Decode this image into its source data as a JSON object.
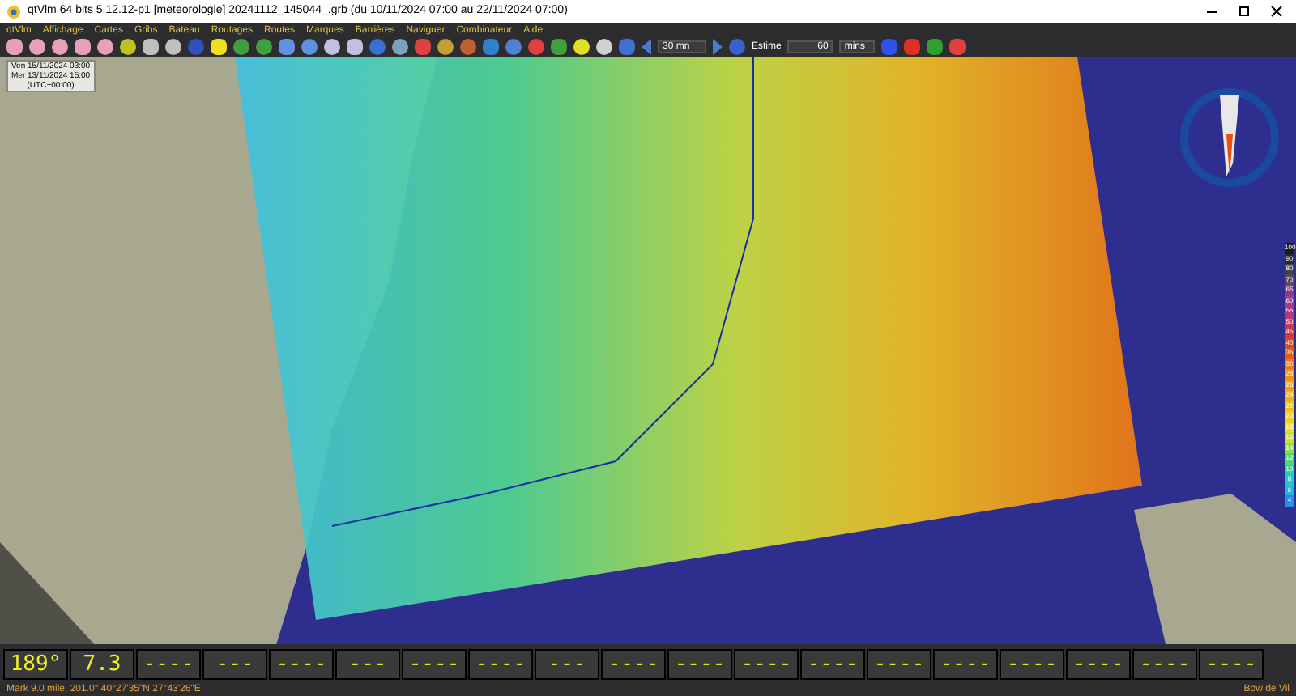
{
  "window": {
    "title": "qtVlm 64 bits 5.12.12-p1 [meteorologie] 20241112_145044_.grb (du 10/11/2024 07:00 au 22/11/2024 07:00)"
  },
  "menu": [
    "qtVlm",
    "Affichage",
    "Cartes",
    "Gribs",
    "Bateau",
    "Routages",
    "Routes",
    "Marques",
    "Barrières",
    "Naviguer",
    "Combinateur",
    "Aide"
  ],
  "toolbar": {
    "step": "30 mn",
    "estime_label": "Estime",
    "estime_value": "60",
    "estime_unit": "mins"
  },
  "time_box": [
    "Ven 15/11/2024 03:00",
    "Mer 13/11/2024 15:00",
    "(UTC+00:00)"
  ],
  "legend": [
    {
      "label": "100",
      "color": "#1a1a1a"
    },
    {
      "label": "90",
      "color": "#2a2a2a"
    },
    {
      "label": "80",
      "color": "#444444"
    },
    {
      "label": "70",
      "color": "#5a4a5a"
    },
    {
      "label": "65",
      "color": "#8a3a8a"
    },
    {
      "label": "60",
      "color": "#a03a9a"
    },
    {
      "label": "55",
      "color": "#b03a80"
    },
    {
      "label": "50",
      "color": "#c03a60"
    },
    {
      "label": "45",
      "color": "#d03a40"
    },
    {
      "label": "40",
      "color": "#e04a20"
    },
    {
      "label": "35",
      "color": "#e86010"
    },
    {
      "label": "30",
      "color": "#f07810"
    },
    {
      "label": "28",
      "color": "#f09010"
    },
    {
      "label": "26",
      "color": "#f0a010"
    },
    {
      "label": "24",
      "color": "#f0b010"
    },
    {
      "label": "22",
      "color": "#f0c010"
    },
    {
      "label": "20",
      "color": "#f0d020"
    },
    {
      "label": "18",
      "color": "#e8e020"
    },
    {
      "label": "16",
      "color": "#c8e030"
    },
    {
      "label": "14",
      "color": "#90e040"
    },
    {
      "label": "12",
      "color": "#50d870"
    },
    {
      "label": "10",
      "color": "#30d0a0"
    },
    {
      "label": "8",
      "color": "#20c8c8"
    },
    {
      "label": "6",
      "color": "#20b8e0"
    },
    {
      "label": "4",
      "color": "#2090f0"
    }
  ],
  "dashboard": [
    "189°",
    "7.3",
    "----",
    "---",
    "----",
    "---",
    "----",
    "----",
    "---",
    "----",
    "----",
    "----",
    "----",
    "----",
    "----",
    "----",
    "----",
    "----",
    "----"
  ],
  "status_bar": {
    "left": "Mark 9.0 mile, 201.0° 40°27'35\"N 27°43'26\"E",
    "right": "Bow de Vil"
  }
}
